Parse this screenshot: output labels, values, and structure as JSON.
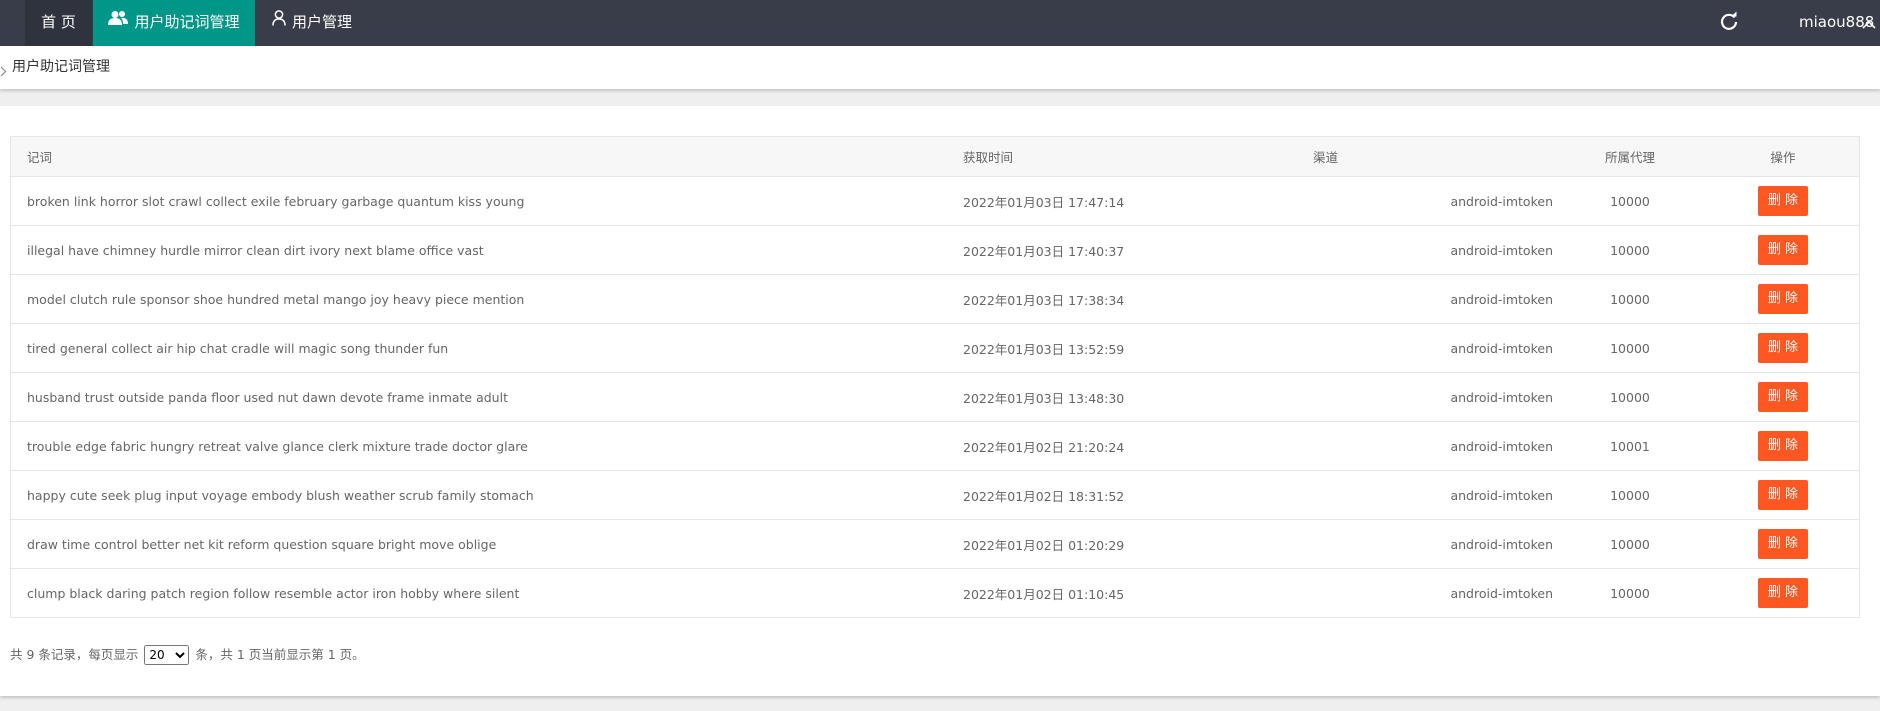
{
  "nav": {
    "home": "首 页",
    "mnemonic_mgmt": "用户助记词管理",
    "user_mgmt": "用户管理",
    "username": "miaou888"
  },
  "breadcrumb": {
    "label": "用户助记词管理"
  },
  "table": {
    "headers": {
      "words": "记词",
      "time": "获取时间",
      "channel": "渠道",
      "agent": "所属代理",
      "action": "操作"
    },
    "rows": [
      {
        "words": "broken link horror slot crawl collect exile february garbage quantum kiss young",
        "time": "2022年01月03日 17:47:14",
        "channel": "android-imtoken",
        "agent": "10000",
        "action": "删 除"
      },
      {
        "words": "illegal have chimney hurdle mirror clean dirt ivory next blame office vast",
        "time": "2022年01月03日 17:40:37",
        "channel": "android-imtoken",
        "agent": "10000",
        "action": "删 除"
      },
      {
        "words": "model clutch rule sponsor shoe hundred metal mango joy heavy piece mention",
        "time": "2022年01月03日 17:38:34",
        "channel": "android-imtoken",
        "agent": "10000",
        "action": "删 除"
      },
      {
        "words": "tired general collect air hip chat cradle will magic song thunder fun",
        "time": "2022年01月03日 13:52:59",
        "channel": "android-imtoken",
        "agent": "10000",
        "action": "删 除"
      },
      {
        "words": "husband trust outside panda floor used nut dawn devote frame inmate adult",
        "time": "2022年01月03日 13:48:30",
        "channel": "android-imtoken",
        "agent": "10000",
        "action": "删 除"
      },
      {
        "words": "trouble edge fabric hungry retreat valve glance clerk mixture trade doctor glare",
        "time": "2022年01月02日 21:20:24",
        "channel": "android-imtoken",
        "agent": "10001",
        "action": "删 除"
      },
      {
        "words": "happy cute seek plug input voyage embody blush weather scrub family stomach",
        "time": "2022年01月02日 18:31:52",
        "channel": "android-imtoken",
        "agent": "10000",
        "action": "删 除"
      },
      {
        "words": "draw time control better net kit reform question square bright move oblige",
        "time": "2022年01月02日 01:20:29",
        "channel": "android-imtoken",
        "agent": "10000",
        "action": "删 除"
      },
      {
        "words": "clump black daring patch region follow resemble actor iron hobby where silent",
        "time": "2022年01月02日 01:10:45",
        "channel": "android-imtoken",
        "agent": "10000",
        "action": "删 除"
      }
    ]
  },
  "pager": {
    "prefix": "共 9 条记录，每页显示",
    "page_size": "20",
    "suffix": "条，共 1 页当前显示第 1 页。"
  },
  "colors": {
    "topbar": "#393d49",
    "active_tab": "#009688",
    "danger": "#ff5722"
  }
}
